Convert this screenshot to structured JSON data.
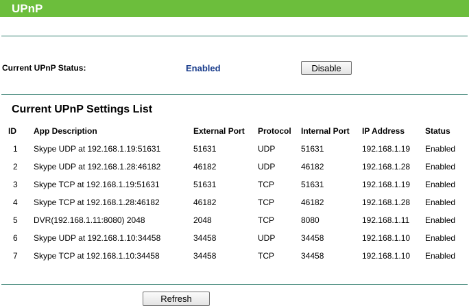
{
  "header": {
    "title": "UPnP"
  },
  "status": {
    "label": "Current UPnP Status:",
    "value": "Enabled",
    "disable_button": "Disable"
  },
  "settings_list": {
    "title": "Current UPnP Settings List",
    "columns": [
      "ID",
      "App Description",
      "External Port",
      "Protocol",
      "Internal Port",
      "IP Address",
      "Status"
    ],
    "rows": [
      [
        "1",
        "Skype UDP at 192.168.1.19:51631",
        "51631",
        "UDP",
        "51631",
        "192.168.1.19",
        "Enabled"
      ],
      [
        "2",
        "Skype UDP at 192.168.1.28:46182",
        "46182",
        "UDP",
        "46182",
        "192.168.1.28",
        "Enabled"
      ],
      [
        "3",
        "Skype TCP at 192.168.1.19:51631",
        "51631",
        "TCP",
        "51631",
        "192.168.1.19",
        "Enabled"
      ],
      [
        "4",
        "Skype TCP at 192.168.1.28:46182",
        "46182",
        "TCP",
        "46182",
        "192.168.1.28",
        "Enabled"
      ],
      [
        "5",
        "DVR(192.168.1.11:8080) 2048",
        "2048",
        "TCP",
        "8080",
        "192.168.1.11",
        "Enabled"
      ],
      [
        "6",
        "Skype UDP at 192.168.1.10:34458",
        "34458",
        "UDP",
        "34458",
        "192.168.1.10",
        "Enabled"
      ],
      [
        "7",
        "Skype TCP at 192.168.1.10:34458",
        "34458",
        "TCP",
        "34458",
        "192.168.1.10",
        "Enabled"
      ]
    ]
  },
  "footer": {
    "refresh_button": "Refresh"
  },
  "colors": {
    "header_bg": "#6cbe3c",
    "rule": "#2e7b6b",
    "status_value": "#1a3d8c"
  }
}
